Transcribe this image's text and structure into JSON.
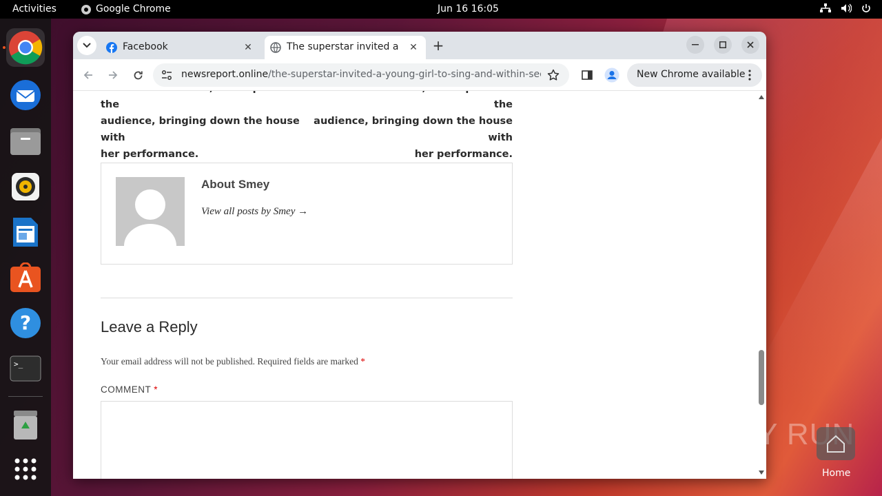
{
  "topbar": {
    "activities": "Activities",
    "app_name": "Google Chrome",
    "datetime": "Jun 16  16:05"
  },
  "dock": {
    "apps": [
      "chrome-icon",
      "thunderbird-icon",
      "files-icon",
      "rhythmbox-icon",
      "writer-icon",
      "software-icon",
      "help-icon",
      "terminal-icon",
      "trash-icon",
      "app-grid-icon"
    ]
  },
  "browser": {
    "tabs": [
      {
        "title": "Facebook",
        "favicon": "facebook-icon"
      },
      {
        "title": "The superstar invited a y",
        "favicon": "globe-icon"
      }
    ],
    "url_domain": "newsreport.online",
    "url_path": "/the-superstar-invited-a-young-girl-to-sing-and-within-second...",
    "new_chrome": "New Chrome available"
  },
  "page": {
    "left_col_lines": [
      "and within seconds, she captivated the",
      "audience, bringing down the house with",
      "her performance."
    ],
    "right_col_lines": [
      "and within seconds, she captivated the",
      "audience, bringing down the house with",
      "her performance."
    ],
    "author_title": "About Smey",
    "author_link": "View all posts by Smey →",
    "reply_title": "Leave a Reply",
    "reply_note": "Your email address will not be published.",
    "reply_required": "Required fields are marked",
    "required_mark": "*",
    "comment_label": "COMMENT",
    "comment_required": "*"
  },
  "desktop": {
    "watermark": "ANY RUN",
    "home_label": "Home"
  },
  "colors": {
    "accent_red": "#e01b24",
    "chrome_tab_strip": "#dfe3e8"
  }
}
